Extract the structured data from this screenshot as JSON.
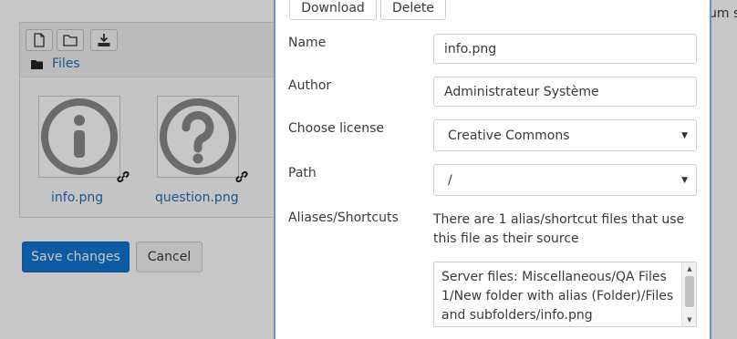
{
  "background": {
    "toolbar": {
      "new_file_icon": "file-icon",
      "new_folder_icon": "folder-icon",
      "download_icon": "download-icon"
    },
    "breadcrumb_label": "Files",
    "files": [
      {
        "name": "info.png",
        "icon": "info-icon"
      },
      {
        "name": "question.png",
        "icon": "question-icon"
      }
    ],
    "save_label": "Save changes",
    "cancel_label": "Cancel",
    "top_right_text": "um s"
  },
  "dialog": {
    "download_label": "Download",
    "delete_label": "Delete",
    "name_label": "Name",
    "name_value": "info.png",
    "author_label": "Author",
    "author_value": "Administrateur Système",
    "license_label": "Choose license",
    "license_value": "Creative Commons",
    "path_label": "Path",
    "path_value": "/",
    "aliases_label": "Aliases/Shortcuts",
    "aliases_text": "There are 1 alias/shortcut files that use this file as their source",
    "aliases_list": "Server files: Miscellaneous/QA Files 1/New folder with alias (Folder)/Files and subfolders/info.png"
  },
  "colors": {
    "primary": "#1177d1",
    "link": "#1f6fb5",
    "dialog_border": "#6b8fc9"
  }
}
